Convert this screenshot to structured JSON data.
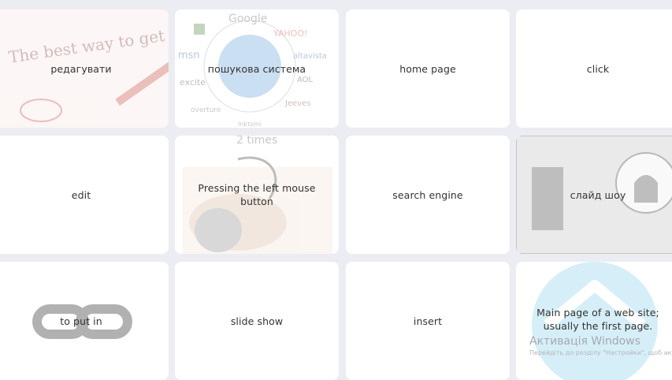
{
  "cards": [
    {
      "label": "редагувати"
    },
    {
      "label": "пошукова система"
    },
    {
      "label": "home page"
    },
    {
      "label": "click"
    },
    {
      "label": "edit"
    },
    {
      "label": "Pressing the left mouse button"
    },
    {
      "label": "search engine"
    },
    {
      "label": "слайд шоу"
    },
    {
      "label": "to put in"
    },
    {
      "label": "slide show"
    },
    {
      "label": "insert"
    },
    {
      "label": "Main page of a web site; usually the first page."
    }
  ],
  "image_text": {
    "handwriting": "The best way to get a you learn on the you're",
    "search_logos": [
      "Google",
      "YAHOO!",
      "msn",
      "altavista",
      "excite",
      "AOL",
      "overture",
      "Jeeves",
      "Inktomi"
    ],
    "mouse_caption": "2 times"
  },
  "watermark": {
    "title": "Активація Windows",
    "subtitle": "Перейдіть до розділу \"Настройки\", щоб активувати Windows."
  }
}
